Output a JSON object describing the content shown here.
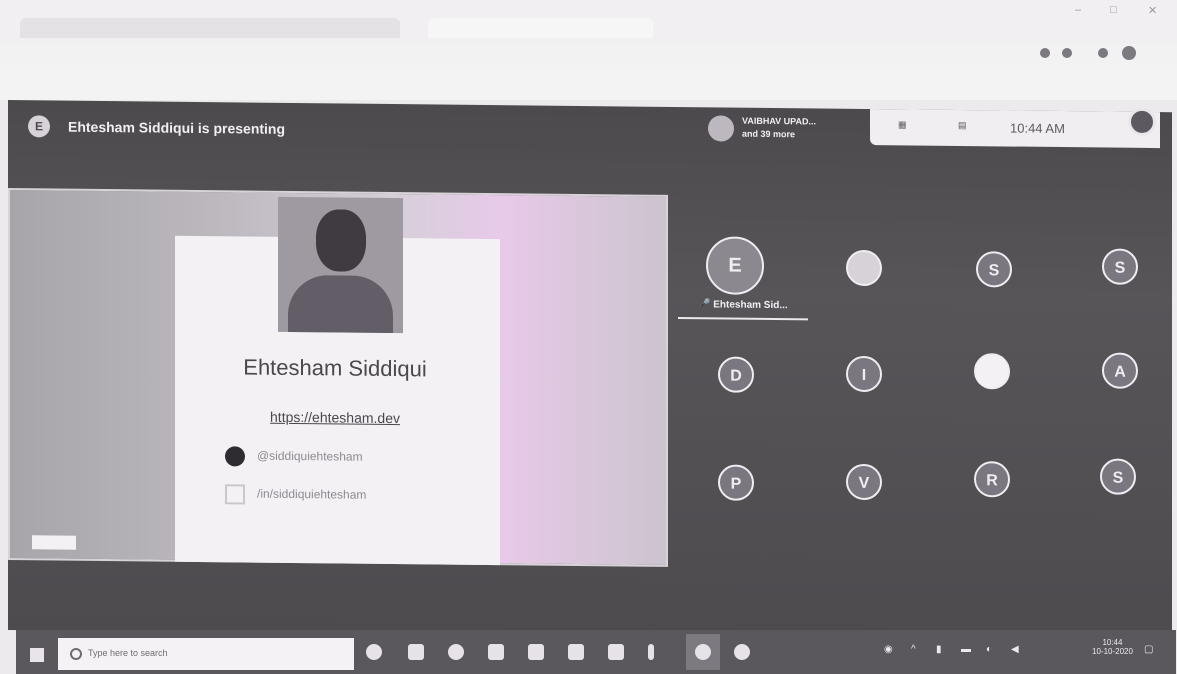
{
  "meet": {
    "presenter_initial": "E",
    "presenting_text": "Ehtesham Siddiqui is presenting",
    "people_name": "VAIBHAV UPAD...",
    "people_more": "and 39 more",
    "clock": "10:44 AM"
  },
  "slide": {
    "name": "Ehtesham Siddiqui",
    "website": "https://ehtesham.dev",
    "github": "@siddiquiehtesham",
    "twitter": "/in/siddiquiehtesham"
  },
  "participants": [
    {
      "initial": "E"
    },
    {
      "initial": ""
    },
    {
      "initial": "S"
    },
    {
      "initial": "S"
    },
    {
      "initial": "D"
    },
    {
      "initial": "I"
    },
    {
      "initial": ""
    },
    {
      "initial": "A"
    },
    {
      "initial": "P"
    },
    {
      "initial": "V"
    },
    {
      "initial": "R"
    },
    {
      "initial": "S"
    }
  ],
  "speaker_label": "Ehtesham Sid...",
  "taskbar": {
    "search_placeholder": "Type here to search",
    "time": "10:44",
    "date": "10-10-2020"
  },
  "icons": {
    "start": "windows-logo-icon",
    "github": "github-icon",
    "twitter": "twitter-icon"
  }
}
